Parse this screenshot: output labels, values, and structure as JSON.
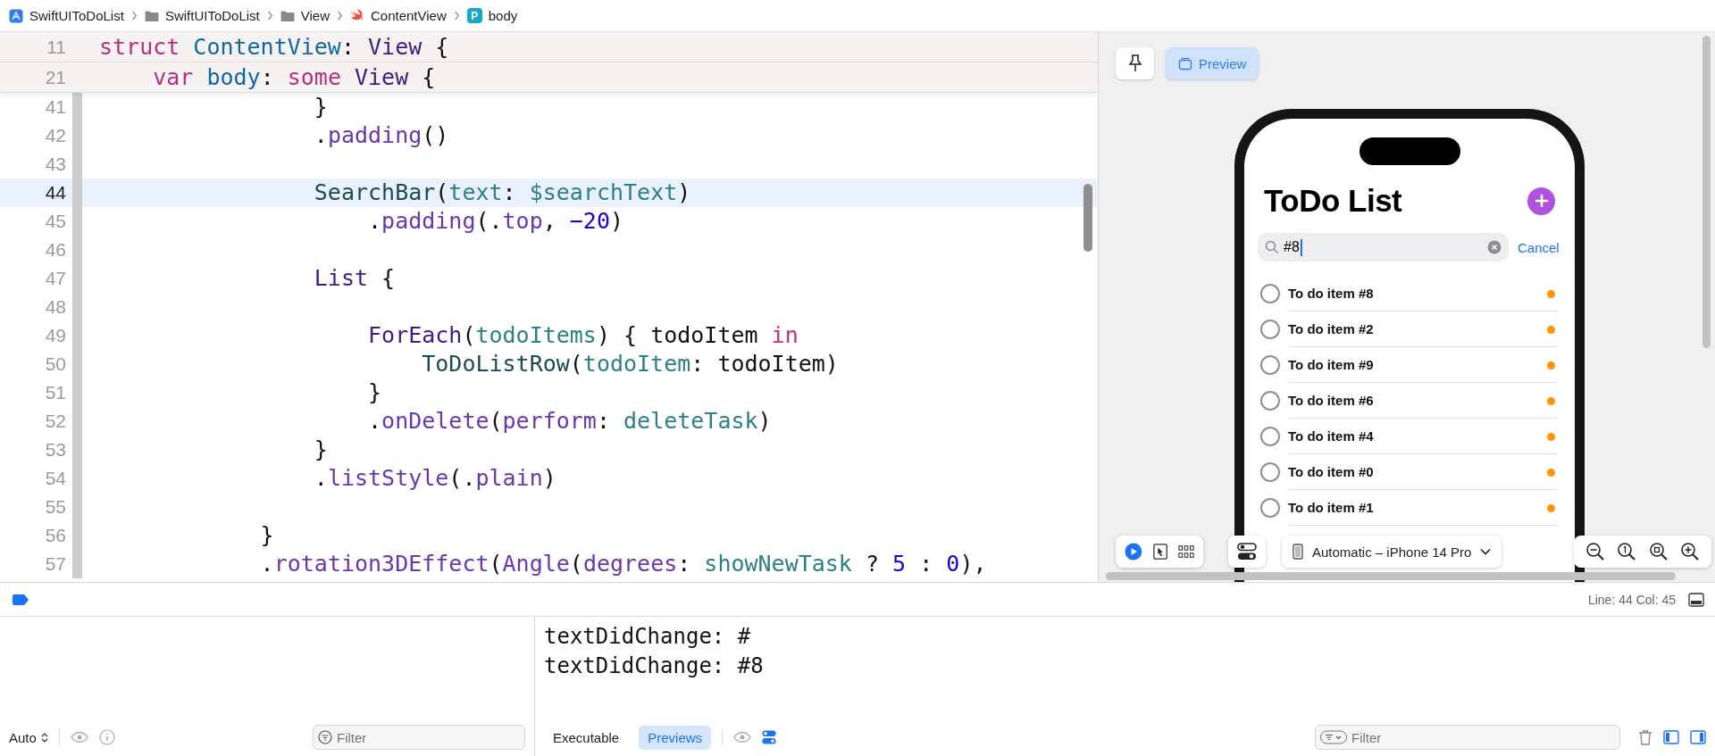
{
  "breadcrumb": [
    {
      "label": "SwiftUIToDoList",
      "kind": "app"
    },
    {
      "label": "SwiftUIToDoList",
      "kind": "folder"
    },
    {
      "label": "View",
      "kind": "folder"
    },
    {
      "label": "ContentView",
      "kind": "swift"
    },
    {
      "label": "body",
      "kind": "property",
      "badge": "P"
    }
  ],
  "editor": {
    "sticky_lines": [
      {
        "number": "11",
        "tokens": [
          {
            "text": "struct ",
            "kind": "keyword"
          },
          {
            "text": "ContentView",
            "kind": "decl"
          },
          {
            "text": ": ",
            "kind": "plain"
          },
          {
            "text": "View",
            "kind": "type"
          },
          {
            "text": " {",
            "kind": "plain"
          }
        ]
      },
      {
        "number": "21",
        "tokens": [
          {
            "text": "    var ",
            "kind": "keyword"
          },
          {
            "text": "body",
            "kind": "decl"
          },
          {
            "text": ": ",
            "kind": "plain"
          },
          {
            "text": "some ",
            "kind": "keyword"
          },
          {
            "text": "View",
            "kind": "type"
          },
          {
            "text": " {",
            "kind": "plain"
          }
        ]
      }
    ],
    "lines": [
      {
        "number": "41",
        "current": false,
        "tokens": [
          {
            "text": "                }",
            "kind": "plain"
          }
        ]
      },
      {
        "number": "42",
        "current": false,
        "tokens": [
          {
            "text": "                .",
            "kind": "plain"
          },
          {
            "text": "padding",
            "kind": "method"
          },
          {
            "text": "()",
            "kind": "plain"
          }
        ]
      },
      {
        "number": "43",
        "current": false
      },
      {
        "number": "44",
        "current": true,
        "tokens": [
          {
            "text": "                SearchBar",
            "kind": "project"
          },
          {
            "text": "(",
            "kind": "plain"
          },
          {
            "text": "text",
            "kind": "ident"
          },
          {
            "text": ": ",
            "kind": "plain"
          },
          {
            "text": "$searchText",
            "kind": "ident"
          },
          {
            "text": ")",
            "kind": "plain"
          }
        ]
      },
      {
        "number": "45",
        "current": false,
        "tokens": [
          {
            "text": "                    .",
            "kind": "plain"
          },
          {
            "text": "padding",
            "kind": "method"
          },
          {
            "text": "(.",
            "kind": "plain"
          },
          {
            "text": "top",
            "kind": "method"
          },
          {
            "text": ", ",
            "kind": "plain"
          },
          {
            "text": "−20",
            "kind": "number"
          },
          {
            "text": ")",
            "kind": "plain"
          }
        ]
      },
      {
        "number": "46",
        "current": false
      },
      {
        "number": "47",
        "current": false,
        "tokens": [
          {
            "text": "                List",
            "kind": "type"
          },
          {
            "text": " {",
            "kind": "plain"
          }
        ]
      },
      {
        "number": "48",
        "current": false
      },
      {
        "number": "49",
        "current": false,
        "tokens": [
          {
            "text": "                    ForEach",
            "kind": "type"
          },
          {
            "text": "(",
            "kind": "plain"
          },
          {
            "text": "todoItems",
            "kind": "ident"
          },
          {
            "text": ") { todoItem ",
            "kind": "plain"
          },
          {
            "text": "in",
            "kind": "keyword"
          }
        ]
      },
      {
        "number": "50",
        "current": false,
        "tokens": [
          {
            "text": "                        ToDoListRow",
            "kind": "project"
          },
          {
            "text": "(",
            "kind": "plain"
          },
          {
            "text": "todoItem",
            "kind": "ident"
          },
          {
            "text": ": todoItem)",
            "kind": "plain"
          }
        ]
      },
      {
        "number": "51",
        "current": false,
        "tokens": [
          {
            "text": "                    }",
            "kind": "plain"
          }
        ]
      },
      {
        "number": "52",
        "current": false,
        "tokens": [
          {
            "text": "                    .",
            "kind": "plain"
          },
          {
            "text": "onDelete",
            "kind": "method"
          },
          {
            "text": "(",
            "kind": "plain"
          },
          {
            "text": "perform",
            "kind": "method"
          },
          {
            "text": ": ",
            "kind": "plain"
          },
          {
            "text": "deleteTask",
            "kind": "ident"
          },
          {
            "text": ")",
            "kind": "plain"
          }
        ]
      },
      {
        "number": "53",
        "current": false,
        "tokens": [
          {
            "text": "                }",
            "kind": "plain"
          }
        ]
      },
      {
        "number": "54",
        "current": false,
        "tokens": [
          {
            "text": "                .",
            "kind": "plain"
          },
          {
            "text": "listStyle",
            "kind": "method"
          },
          {
            "text": "(.",
            "kind": "plain"
          },
          {
            "text": "plain",
            "kind": "method"
          },
          {
            "text": ")",
            "kind": "plain"
          }
        ]
      },
      {
        "number": "55",
        "current": false
      },
      {
        "number": "56",
        "current": false,
        "tokens": [
          {
            "text": "            }",
            "kind": "plain"
          }
        ]
      },
      {
        "number": "57",
        "current": false,
        "tokens": [
          {
            "text": "            .",
            "kind": "plain"
          },
          {
            "text": "rotation3DEffect",
            "kind": "method"
          },
          {
            "text": "(",
            "kind": "plain"
          },
          {
            "text": "Angle",
            "kind": "method"
          },
          {
            "text": "(",
            "kind": "plain"
          },
          {
            "text": "degrees",
            "kind": "method"
          },
          {
            "text": ": ",
            "kind": "plain"
          },
          {
            "text": "showNewTask",
            "kind": "ident"
          },
          {
            "text": " ? ",
            "kind": "plain"
          },
          {
            "text": "5",
            "kind": "number"
          },
          {
            "text": " : ",
            "kind": "plain"
          },
          {
            "text": "0",
            "kind": "number"
          },
          {
            "text": "),",
            "kind": "plain"
          }
        ]
      }
    ]
  },
  "preview": {
    "mode_button": {
      "label": "Preview",
      "selected": true
    },
    "app": {
      "title": "ToDo List",
      "search": {
        "value": "#8"
      },
      "cancel": "Cancel",
      "items": [
        {
          "label": "To do item #8",
          "checked": false,
          "color": "#ff9500"
        },
        {
          "label": "To do item #2",
          "checked": false,
          "color": "#ff9500"
        },
        {
          "label": "To do item #9",
          "checked": false,
          "color": "#ff9500"
        },
        {
          "label": "To do item #6",
          "checked": false,
          "color": "#ff9500"
        },
        {
          "label": "To do item #4",
          "checked": false,
          "color": "#ff9500"
        },
        {
          "label": "To do item #0",
          "checked": false,
          "color": "#ff9500"
        },
        {
          "label": "To do item #1",
          "checked": false,
          "color": "#ff9500"
        }
      ]
    },
    "device": "Automatic – iPhone 14 Pro"
  },
  "status": {
    "position": "Line: 44  Col: 45"
  },
  "console": {
    "output": [
      "textDidChange: #",
      "textDidChange: #8"
    ]
  },
  "variables_bar": {
    "scope": "Auto",
    "filter_placeholder": "Filter"
  },
  "console_bar": {
    "tabs": [
      {
        "label": "Executable",
        "selected": false
      },
      {
        "label": "Previews",
        "selected": true
      }
    ],
    "filter_placeholder": "Filter"
  }
}
